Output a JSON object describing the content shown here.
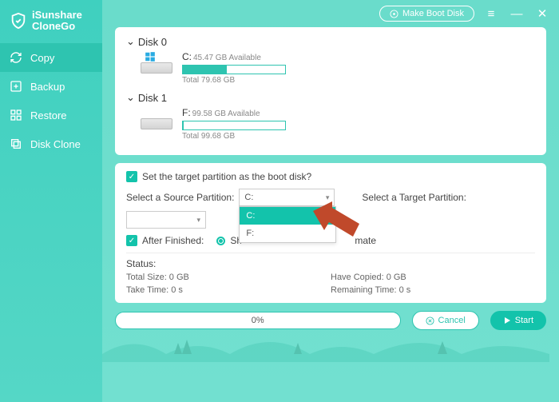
{
  "brand": {
    "line1": "iSunshare",
    "line2": "CloneGo"
  },
  "titlebar": {
    "make_boot": "Make Boot Disk"
  },
  "nav": [
    {
      "label": "Copy",
      "icon": "refresh-icon",
      "active": true
    },
    {
      "label": "Backup",
      "icon": "plus-box-icon",
      "active": false
    },
    {
      "label": "Restore",
      "icon": "grid-icon",
      "active": false
    },
    {
      "label": "Disk Clone",
      "icon": "clone-icon",
      "active": false
    }
  ],
  "disks": [
    {
      "title": "Disk 0",
      "letter": "C:",
      "avail": "45.47 GB Available",
      "total": "Total 79.68 GB",
      "fill_pct": 43,
      "os": true
    },
    {
      "title": "Disk 1",
      "letter": "F:",
      "avail": "99.58 GB Available",
      "total": "Total 99.68 GB",
      "fill_pct": 1,
      "os": false
    }
  ],
  "options": {
    "boot_checkbox_label": "Set the target partition as the boot disk?",
    "source_label": "Select a Source Partition:",
    "source_value": "C:",
    "source_options": [
      "C:",
      "F:"
    ],
    "target_label": "Select a Target Partition:",
    "target_value": "",
    "after_label": "After Finished:",
    "after_radio1": "Shutdown",
    "after_radio2_suffix": "mate"
  },
  "status": {
    "heading": "Status:",
    "total_size": "Total Size: 0 GB",
    "have_copied": "Have Copied: 0 GB",
    "take_time": "Take Time: 0 s",
    "remaining": "Remaining Time: 0 s"
  },
  "footer": {
    "progress_text": "0%",
    "cancel": "Cancel",
    "start": "Start"
  }
}
